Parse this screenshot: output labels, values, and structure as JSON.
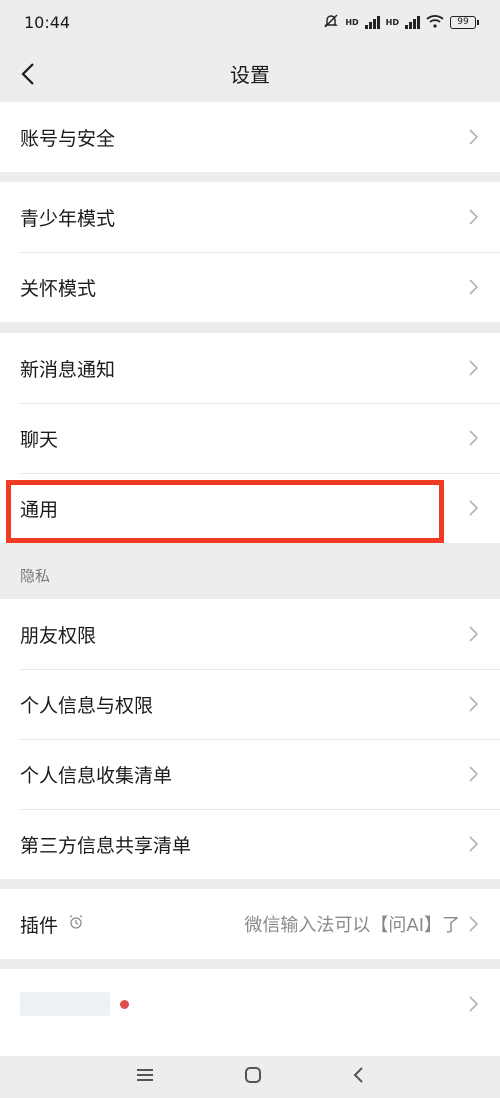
{
  "status_bar": {
    "time": "10:44",
    "hd1": "HD",
    "hd2": "HD",
    "battery": "99"
  },
  "header": {
    "title": "设置"
  },
  "groups": {
    "account": {
      "items": [
        {
          "label": "账号与安全"
        }
      ]
    },
    "modes": {
      "items": [
        {
          "label": "青少年模式"
        },
        {
          "label": "关怀模式"
        }
      ]
    },
    "general": {
      "items": [
        {
          "label": "新消息通知"
        },
        {
          "label": "聊天"
        },
        {
          "label": "通用"
        }
      ]
    },
    "privacy": {
      "title": "隐私",
      "items": [
        {
          "label": "朋友权限"
        },
        {
          "label": "个人信息与权限"
        },
        {
          "label": "个人信息收集清单"
        },
        {
          "label": "第三方信息共享清单"
        }
      ]
    },
    "plugins": {
      "label": "插件",
      "value": "微信输入法可以【问AI】了"
    }
  },
  "colors": {
    "highlight": "#f03a22",
    "background": "#ededed",
    "notification_dot": "#e04f4f"
  }
}
